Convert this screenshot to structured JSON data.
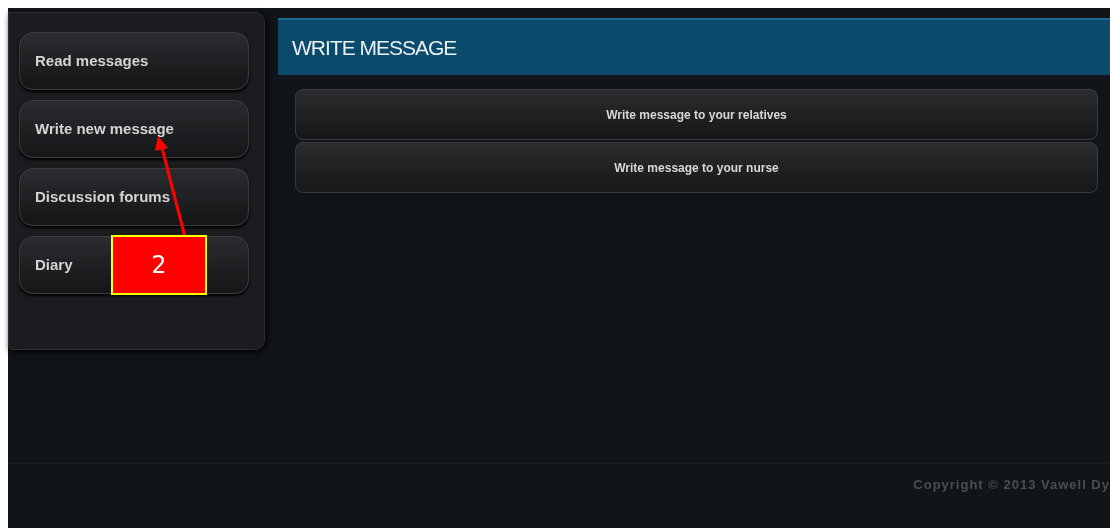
{
  "sidebar": {
    "items": [
      {
        "label": "Read messages"
      },
      {
        "label": "Write new message"
      },
      {
        "label": "Discussion forums"
      },
      {
        "label": "Diary"
      }
    ]
  },
  "header": {
    "title": "WRITE MESSAGE"
  },
  "actions": [
    {
      "label": "Write message to your relatives"
    },
    {
      "label": "Write message to your nurse"
    }
  ],
  "annotation": {
    "label": "2"
  },
  "footer": {
    "copyright": "Copyright © 2013 Vawell Dy"
  }
}
